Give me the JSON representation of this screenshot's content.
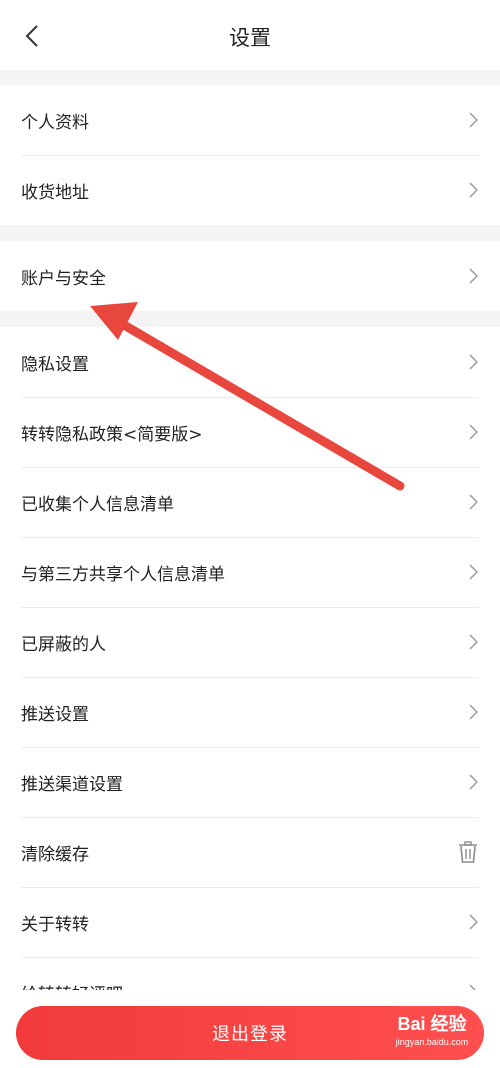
{
  "header": {
    "title": "设置"
  },
  "groups": [
    {
      "items": [
        {
          "label": "个人资料",
          "icon": "chevron-right-icon"
        },
        {
          "label": "收货地址",
          "icon": "chevron-right-icon"
        }
      ]
    },
    {
      "items": [
        {
          "label": "账户与安全",
          "icon": "chevron-right-icon"
        }
      ]
    },
    {
      "items": [
        {
          "label": "隐私设置",
          "icon": "chevron-right-icon"
        },
        {
          "label": "转转隐私政策<简要版>",
          "icon": "chevron-right-icon"
        },
        {
          "label": "已收集个人信息清单",
          "icon": "chevron-right-icon"
        },
        {
          "label": "与第三方共享个人信息清单",
          "icon": "chevron-right-icon"
        },
        {
          "label": "已屏蔽的人",
          "icon": "chevron-right-icon"
        },
        {
          "label": "推送设置",
          "icon": "chevron-right-icon"
        },
        {
          "label": "推送渠道设置",
          "icon": "chevron-right-icon"
        },
        {
          "label": "清除缓存",
          "icon": "trash-icon"
        },
        {
          "label": "关于转转",
          "icon": "chevron-right-icon"
        },
        {
          "label": "给转转好评吧",
          "icon": "chevron-right-icon"
        }
      ]
    }
  ],
  "logout": {
    "label": "退出登录"
  },
  "watermark": {
    "logo": "Bai 经验",
    "url": "jingyan.baidu.com"
  },
  "colors": {
    "accent": "#f23a3a",
    "annotation_arrow": "#e8473d"
  }
}
